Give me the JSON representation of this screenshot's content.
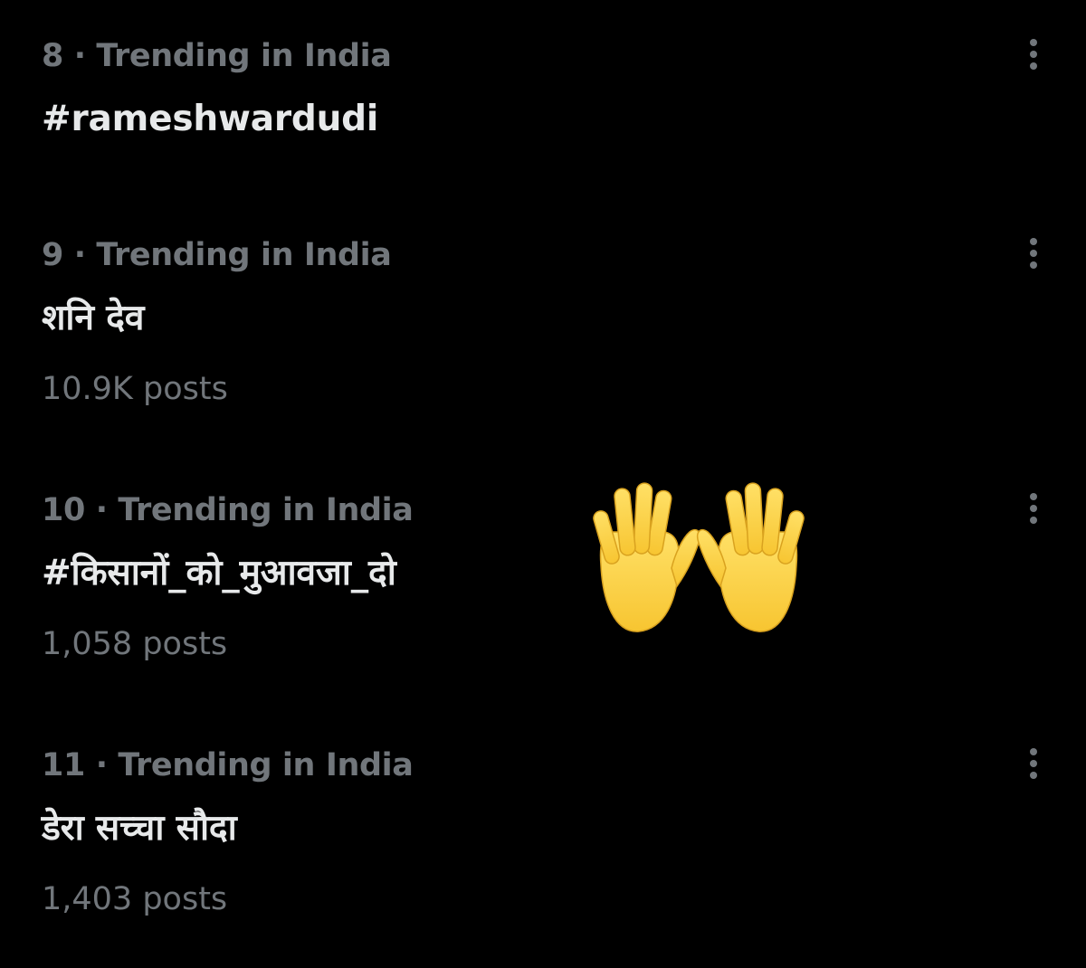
{
  "trends": [
    {
      "rank_label": "8 · Trending in India",
      "title": "#rameshwardudi",
      "post_count": ""
    },
    {
      "rank_label": "9 · Trending in India",
      "title": "शनि देव",
      "post_count": "10.9K posts"
    },
    {
      "rank_label": "10 · Trending in India",
      "title": "#किसानों_को_मुआवजा_दो",
      "post_count": "1,058 posts"
    },
    {
      "rank_label": "11 · Trending in India",
      "title": "डेरा सच्चा सौदा",
      "post_count": "1,403 posts"
    }
  ],
  "icons": {
    "more": "more-vertical-icon",
    "emoji": "raised-hands-emoji"
  },
  "colors": {
    "background": "#000000",
    "primary_text": "#e7e9ea",
    "secondary_text": "#71767b",
    "emoji_skin": "#ffd23f"
  }
}
